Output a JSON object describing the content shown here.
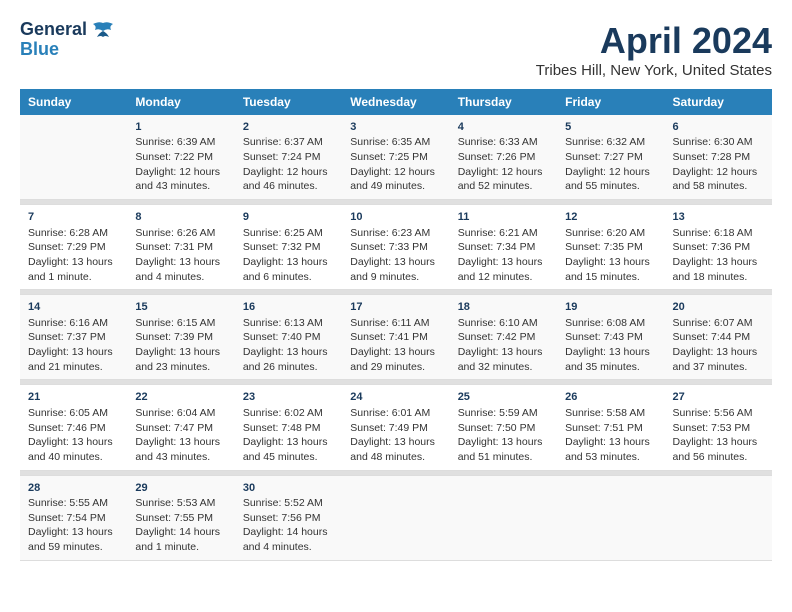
{
  "header": {
    "logo_line1": "General",
    "logo_line2": "Blue",
    "title": "April 2024",
    "subtitle": "Tribes Hill, New York, United States"
  },
  "calendar": {
    "columns": [
      "Sunday",
      "Monday",
      "Tuesday",
      "Wednesday",
      "Thursday",
      "Friday",
      "Saturday"
    ],
    "weeks": [
      [
        {
          "day": "",
          "sunrise": "",
          "sunset": "",
          "daylight": ""
        },
        {
          "day": "1",
          "sunrise": "Sunrise: 6:39 AM",
          "sunset": "Sunset: 7:22 PM",
          "daylight": "Daylight: 12 hours and 43 minutes."
        },
        {
          "day": "2",
          "sunrise": "Sunrise: 6:37 AM",
          "sunset": "Sunset: 7:24 PM",
          "daylight": "Daylight: 12 hours and 46 minutes."
        },
        {
          "day": "3",
          "sunrise": "Sunrise: 6:35 AM",
          "sunset": "Sunset: 7:25 PM",
          "daylight": "Daylight: 12 hours and 49 minutes."
        },
        {
          "day": "4",
          "sunrise": "Sunrise: 6:33 AM",
          "sunset": "Sunset: 7:26 PM",
          "daylight": "Daylight: 12 hours and 52 minutes."
        },
        {
          "day": "5",
          "sunrise": "Sunrise: 6:32 AM",
          "sunset": "Sunset: 7:27 PM",
          "daylight": "Daylight: 12 hours and 55 minutes."
        },
        {
          "day": "6",
          "sunrise": "Sunrise: 6:30 AM",
          "sunset": "Sunset: 7:28 PM",
          "daylight": "Daylight: 12 hours and 58 minutes."
        }
      ],
      [
        {
          "day": "7",
          "sunrise": "Sunrise: 6:28 AM",
          "sunset": "Sunset: 7:29 PM",
          "daylight": "Daylight: 13 hours and 1 minute."
        },
        {
          "day": "8",
          "sunrise": "Sunrise: 6:26 AM",
          "sunset": "Sunset: 7:31 PM",
          "daylight": "Daylight: 13 hours and 4 minutes."
        },
        {
          "day": "9",
          "sunrise": "Sunrise: 6:25 AM",
          "sunset": "Sunset: 7:32 PM",
          "daylight": "Daylight: 13 hours and 6 minutes."
        },
        {
          "day": "10",
          "sunrise": "Sunrise: 6:23 AM",
          "sunset": "Sunset: 7:33 PM",
          "daylight": "Daylight: 13 hours and 9 minutes."
        },
        {
          "day": "11",
          "sunrise": "Sunrise: 6:21 AM",
          "sunset": "Sunset: 7:34 PM",
          "daylight": "Daylight: 13 hours and 12 minutes."
        },
        {
          "day": "12",
          "sunrise": "Sunrise: 6:20 AM",
          "sunset": "Sunset: 7:35 PM",
          "daylight": "Daylight: 13 hours and 15 minutes."
        },
        {
          "day": "13",
          "sunrise": "Sunrise: 6:18 AM",
          "sunset": "Sunset: 7:36 PM",
          "daylight": "Daylight: 13 hours and 18 minutes."
        }
      ],
      [
        {
          "day": "14",
          "sunrise": "Sunrise: 6:16 AM",
          "sunset": "Sunset: 7:37 PM",
          "daylight": "Daylight: 13 hours and 21 minutes."
        },
        {
          "day": "15",
          "sunrise": "Sunrise: 6:15 AM",
          "sunset": "Sunset: 7:39 PM",
          "daylight": "Daylight: 13 hours and 23 minutes."
        },
        {
          "day": "16",
          "sunrise": "Sunrise: 6:13 AM",
          "sunset": "Sunset: 7:40 PM",
          "daylight": "Daylight: 13 hours and 26 minutes."
        },
        {
          "day": "17",
          "sunrise": "Sunrise: 6:11 AM",
          "sunset": "Sunset: 7:41 PM",
          "daylight": "Daylight: 13 hours and 29 minutes."
        },
        {
          "day": "18",
          "sunrise": "Sunrise: 6:10 AM",
          "sunset": "Sunset: 7:42 PM",
          "daylight": "Daylight: 13 hours and 32 minutes."
        },
        {
          "day": "19",
          "sunrise": "Sunrise: 6:08 AM",
          "sunset": "Sunset: 7:43 PM",
          "daylight": "Daylight: 13 hours and 35 minutes."
        },
        {
          "day": "20",
          "sunrise": "Sunrise: 6:07 AM",
          "sunset": "Sunset: 7:44 PM",
          "daylight": "Daylight: 13 hours and 37 minutes."
        }
      ],
      [
        {
          "day": "21",
          "sunrise": "Sunrise: 6:05 AM",
          "sunset": "Sunset: 7:46 PM",
          "daylight": "Daylight: 13 hours and 40 minutes."
        },
        {
          "day": "22",
          "sunrise": "Sunrise: 6:04 AM",
          "sunset": "Sunset: 7:47 PM",
          "daylight": "Daylight: 13 hours and 43 minutes."
        },
        {
          "day": "23",
          "sunrise": "Sunrise: 6:02 AM",
          "sunset": "Sunset: 7:48 PM",
          "daylight": "Daylight: 13 hours and 45 minutes."
        },
        {
          "day": "24",
          "sunrise": "Sunrise: 6:01 AM",
          "sunset": "Sunset: 7:49 PM",
          "daylight": "Daylight: 13 hours and 48 minutes."
        },
        {
          "day": "25",
          "sunrise": "Sunrise: 5:59 AM",
          "sunset": "Sunset: 7:50 PM",
          "daylight": "Daylight: 13 hours and 51 minutes."
        },
        {
          "day": "26",
          "sunrise": "Sunrise: 5:58 AM",
          "sunset": "Sunset: 7:51 PM",
          "daylight": "Daylight: 13 hours and 53 minutes."
        },
        {
          "day": "27",
          "sunrise": "Sunrise: 5:56 AM",
          "sunset": "Sunset: 7:53 PM",
          "daylight": "Daylight: 13 hours and 56 minutes."
        }
      ],
      [
        {
          "day": "28",
          "sunrise": "Sunrise: 5:55 AM",
          "sunset": "Sunset: 7:54 PM",
          "daylight": "Daylight: 13 hours and 59 minutes."
        },
        {
          "day": "29",
          "sunrise": "Sunrise: 5:53 AM",
          "sunset": "Sunset: 7:55 PM",
          "daylight": "Daylight: 14 hours and 1 minute."
        },
        {
          "day": "30",
          "sunrise": "Sunrise: 5:52 AM",
          "sunset": "Sunset: 7:56 PM",
          "daylight": "Daylight: 14 hours and 4 minutes."
        },
        {
          "day": "",
          "sunrise": "",
          "sunset": "",
          "daylight": ""
        },
        {
          "day": "",
          "sunrise": "",
          "sunset": "",
          "daylight": ""
        },
        {
          "day": "",
          "sunrise": "",
          "sunset": "",
          "daylight": ""
        },
        {
          "day": "",
          "sunrise": "",
          "sunset": "",
          "daylight": ""
        }
      ]
    ]
  }
}
